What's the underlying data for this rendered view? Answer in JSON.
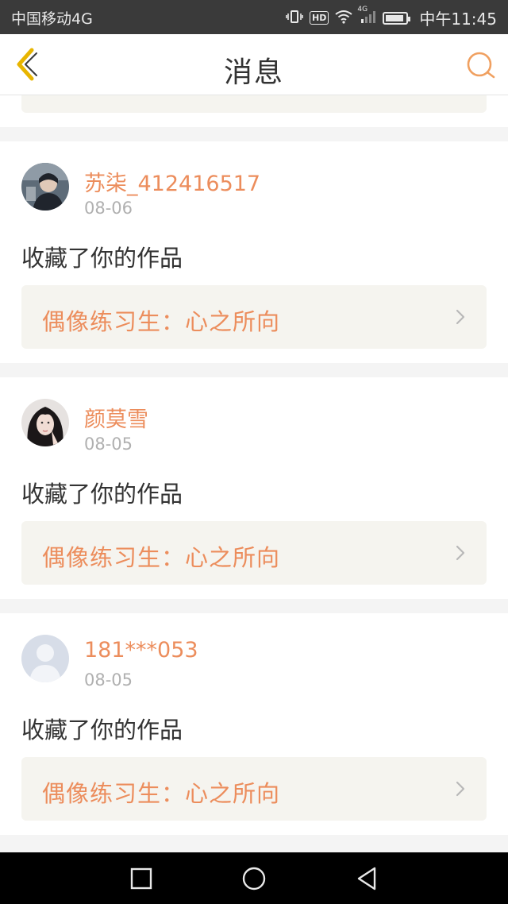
{
  "status_bar": {
    "carrier": "中国移动4G",
    "signal_label": "4G",
    "hd_label": "HD",
    "time": "中午11:45"
  },
  "header": {
    "title": "消息"
  },
  "messages": [
    {
      "username": "苏柒_412416517",
      "date": "08-06",
      "action": "收藏了你的作品",
      "work_title": "偶像练习生：心之所向",
      "avatar": "photo-avatar"
    },
    {
      "username": "颜莫雪",
      "date": "08-05",
      "action": "收藏了你的作品",
      "work_title": "偶像练习生：心之所向",
      "avatar": "photo-avatar"
    },
    {
      "username": "181***053",
      "date": "08-05",
      "action": "收藏了你的作品",
      "work_title": "偶像练习生：心之所向",
      "avatar": "default-avatar"
    }
  ],
  "colors": {
    "accent": "#ec8d5c",
    "back_icon": "#e8b500",
    "search_icon": "#f0a060",
    "card_link_bg": "#f5f4ef"
  },
  "icons": {
    "back": "back-icon",
    "search": "search-icon",
    "nav": [
      "recent-apps-icon",
      "home-icon",
      "back-nav-icon"
    ]
  }
}
